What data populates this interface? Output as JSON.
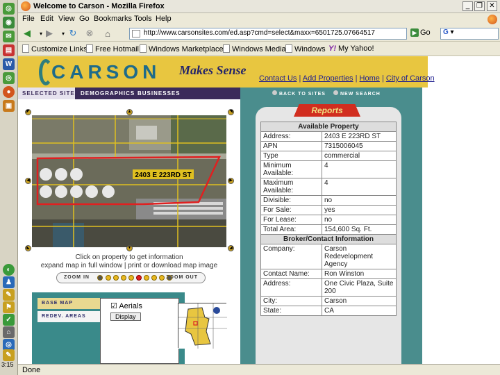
{
  "window": {
    "title": "Welcome to Carson - Mozilla Firefox",
    "controls": [
      "_",
      "❐",
      "✕"
    ]
  },
  "menubar": [
    "File",
    "Edit",
    "View",
    "Go",
    "Bookmarks",
    "Tools",
    "Help"
  ],
  "navbar": {
    "url": "http://www.carsonsites.com/ed.asp?cmd=select&maxx=6501725.07664517",
    "go_label": "Go",
    "search_value": "G"
  },
  "bookmarks": [
    "Customize Links",
    "Free Hotmail",
    "Windows Marketplace",
    "Windows Media",
    "Windows",
    "My Yahoo!"
  ],
  "status": {
    "text": "Done"
  },
  "taskbar": {
    "clock": "3:15"
  },
  "site": {
    "logo_text": "CARSON",
    "tagline": "Makes Sense",
    "header_links": [
      "Contact Us",
      "Add Properties",
      "Home",
      "City of Carson"
    ],
    "tabs": [
      "SELECTED SITE",
      "DEMOGRAPHICS",
      "BUSINESSES"
    ]
  },
  "map": {
    "address_label": "2403 E 223RD ST",
    "caption_line1": "Click on property to get information",
    "caption_line2": "expand map in full window | print or download map image",
    "zoom_in": "ZOOM IN",
    "zoom_out": "ZOOM OUT",
    "zoom_levels": 9,
    "zoom_current": 4
  },
  "layers": {
    "tabs": [
      "BASE MAP",
      "REDEV. AREAS"
    ],
    "aerials_label": "Aerials",
    "aerials_checked": true,
    "display_button": "Display"
  },
  "right": {
    "back_label": "BACK TO SITES",
    "new_search_label": "NEW SEARCH",
    "reports_label": "Reports",
    "available_header": "Available Property",
    "property_rows": [
      {
        "label": "Address:",
        "value": "2403 E 223RD ST"
      },
      {
        "label": "APN",
        "value": "7315006045"
      },
      {
        "label": "Type",
        "value": "commercial"
      },
      {
        "label": "Minimum Available:",
        "value": "4"
      },
      {
        "label": "Maximum Available:",
        "value": "4"
      },
      {
        "label": "Divisible:",
        "value": "no"
      },
      {
        "label": "For Sale:",
        "value": "yes"
      },
      {
        "label": "For Lease:",
        "value": "no"
      },
      {
        "label": "Total Area:",
        "value": "154,600 Sq. Ft."
      }
    ],
    "broker_header": "Broker/Contact Information",
    "broker_rows": [
      {
        "label": "Company:",
        "value": "Carson Redevelopment Agency"
      },
      {
        "label": "Contact Name:",
        "value": "Ron Winston"
      },
      {
        "label": "Address:",
        "value": "One Civic Plaza, Suite 200"
      },
      {
        "label": "City:",
        "value": "Carson"
      },
      {
        "label": "State:",
        "value": "CA"
      }
    ]
  },
  "colors": {
    "header_yellow": "#e8c640",
    "teal": "#4a8d8d",
    "reports_red": "#d12d1f",
    "tab_purple": "#3b2b5a",
    "parcel_outline": "#e02020"
  }
}
